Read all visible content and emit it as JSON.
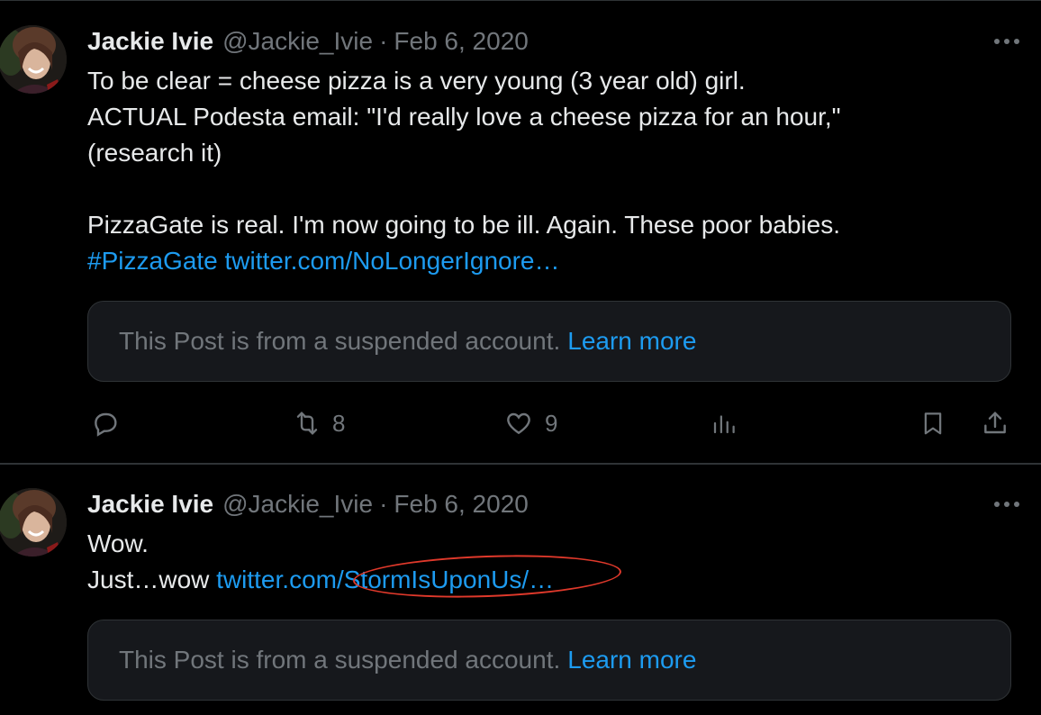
{
  "tweets": [
    {
      "author_name": "Jackie Ivie",
      "handle": "@Jackie_Ivie",
      "separator": "·",
      "date": "Feb 6, 2020",
      "lines": [
        "To be clear = cheese pizza is a very young (3 year old) girl.",
        "ACTUAL Podesta email:  \"I'd really love a cheese pizza for an hour,\"",
        "(research it)",
        "",
        "PizzaGate is real.  I'm now going to be ill. Again.  These poor babies."
      ],
      "hashtag": "#PizzaGate",
      "link_text": "twitter.com/NoLongerIgnore…",
      "suspended_text": "This Post is from a suspended account.",
      "learn_more": "Learn more",
      "actions": {
        "reply": {
          "icon": "reply-icon",
          "count": ""
        },
        "retweet": {
          "icon": "retweet-icon",
          "count": "8"
        },
        "like": {
          "icon": "heart-icon",
          "count": "9"
        },
        "views": {
          "icon": "analytics-icon",
          "count": ""
        },
        "bookmark": {
          "icon": "bookmark-icon"
        },
        "share": {
          "icon": "share-icon"
        }
      }
    },
    {
      "author_name": "Jackie Ivie",
      "handle": "@Jackie_Ivie",
      "separator": "·",
      "date": "Feb 6, 2020",
      "line1": "Wow.",
      "line2_text": "Just…wow ",
      "link_text": "twitter.com/StormIsUponUs/…",
      "suspended_text": "This Post is from a suspended account.",
      "learn_more": "Learn more"
    }
  ],
  "icons": {
    "more": "more-horizontal-icon"
  },
  "colors": {
    "background": "#000000",
    "text": "#e7e9ea",
    "secondary": "#71767b",
    "link": "#1d9bf0",
    "border": "#2f3336",
    "card": "#16181c",
    "annotation": "#e0392b"
  }
}
